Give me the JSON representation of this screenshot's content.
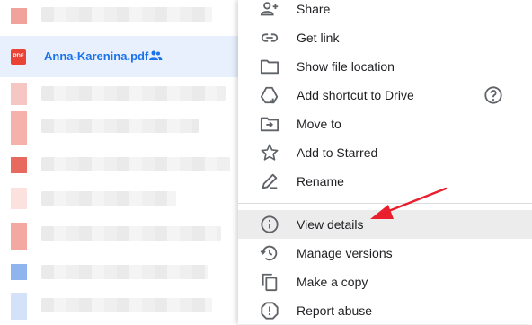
{
  "file": {
    "name": "Anna-Karenina.pdf",
    "type_badge": "PDF"
  },
  "colors": {
    "pdf": "#ea4335",
    "link": "#1a73e8",
    "arrow": "#ea1f2e"
  },
  "menu": {
    "share": "Share",
    "get_link": "Get link",
    "show_location": "Show file location",
    "add_shortcut": "Add shortcut to Drive",
    "move_to": "Move to",
    "add_starred": "Add to Starred",
    "rename": "Rename",
    "view_details": "View details",
    "manage_versions": "Manage versions",
    "make_copy": "Make a copy",
    "report_abuse": "Report abuse"
  }
}
